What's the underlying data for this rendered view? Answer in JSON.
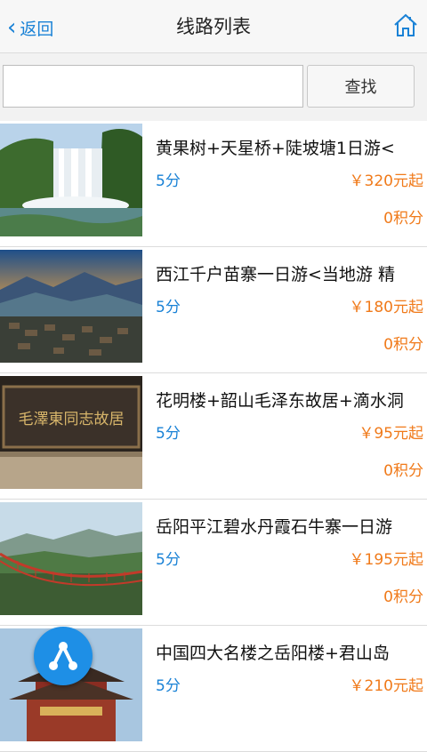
{
  "header": {
    "back_label": "返回",
    "title": "线路列表",
    "home_icon": "home-icon"
  },
  "search": {
    "value": "",
    "placeholder": "",
    "button_label": "查找"
  },
  "routes": [
    {
      "name": "黄果树+天星桥+陡坡塘1日游<",
      "score": "5分",
      "price": "￥320元起",
      "points": "0积分",
      "image": "waterfall"
    },
    {
      "name": "西江千户苗寨一日游<当地游 精",
      "score": "5分",
      "price": "￥180元起",
      "points": "0积分",
      "image": "mountain-village"
    },
    {
      "name": "花明楼+韶山毛泽东故居+滴水洞",
      "score": "5分",
      "price": "￥95元起",
      "points": "0积分",
      "image": "inscription-board",
      "image_text": "毛澤東同志故居"
    },
    {
      "name": "岳阳平江碧水丹霞石牛寨一日游",
      "score": "5分",
      "price": "￥195元起",
      "points": "0积分",
      "image": "suspension-bridge"
    },
    {
      "name": "中国四大名楼之岳阳楼+君山岛",
      "score": "5分",
      "price": "￥210元起",
      "points": "",
      "image": "pavilion"
    }
  ],
  "fab": {
    "icon": "share-icon"
  }
}
